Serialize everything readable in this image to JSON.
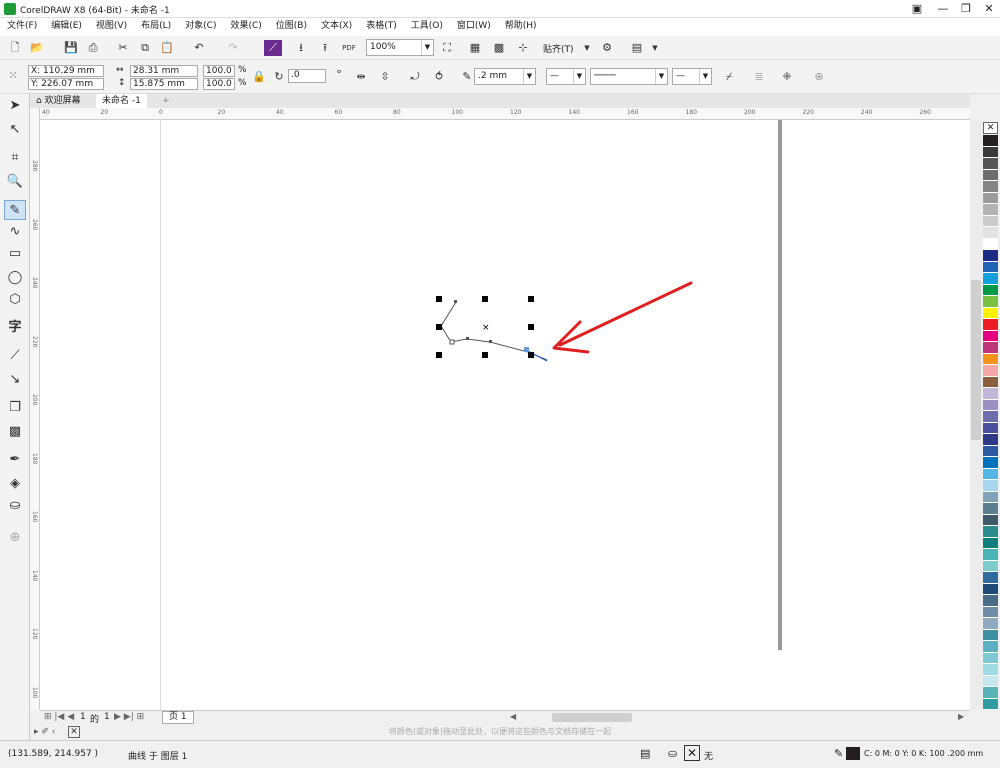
{
  "window": {
    "title": "CorelDRAW X8 (64-Bit) - 未命名 -1"
  },
  "menu": [
    "文件(F)",
    "编辑(E)",
    "视图(V)",
    "布局(L)",
    "对象(C)",
    "效果(C)",
    "位图(B)",
    "文本(X)",
    "表格(T)",
    "工具(O)",
    "窗口(W)",
    "帮助(H)"
  ],
  "toolbar1": {
    "zoom": "100%",
    "snap_label": "贴齐(T)"
  },
  "property_bar": {
    "x": "X: 110.29 mm",
    "y": "Y: 226.07 mm",
    "width": "28.31 mm",
    "height": "15.875 mm",
    "scale_x": "100.0",
    "scale_y": "100.0",
    "pct": "%",
    "rotation": ".0",
    "outline_width": ".2 mm"
  },
  "tabs": [
    {
      "label": "欢迎屏幕"
    },
    {
      "label": "未命名 -1"
    }
  ],
  "ruler": {
    "h_ticks": [
      "40",
      "20",
      "0",
      "20",
      "40",
      "60",
      "80",
      "100",
      "120",
      "140",
      "160",
      "180",
      "200",
      "220",
      "240",
      "260"
    ],
    "v_ticks": [
      "280",
      "260",
      "240",
      "220",
      "200",
      "180",
      "160",
      "140",
      "120",
      "100"
    ]
  },
  "page_nav": {
    "current": "1",
    "of": "的",
    "total": "1",
    "page_tab": "页 1"
  },
  "hint": "将颜色(或对象)拖动至此处，以便将这些颜色与文档存储在一起",
  "status": {
    "coords": "(131.589, 214.957 )",
    "object": "曲线 于 图层 1",
    "fill_none": "无",
    "outline_info": "C: 0 M: 0 Y: 0 K: 100  .200 mm"
  },
  "colors": {
    "arrow": "#e02020",
    "accent": "#1e9c38"
  },
  "palette": [
    "#231f20",
    "#3a3a3a",
    "#555",
    "#6d6d6d",
    "#858585",
    "#9c9c9c",
    "#b3b3b3",
    "#cbcbcb",
    "#e2e2e2",
    "#ffffff",
    "#1b2b86",
    "#1f63b5",
    "#12a1dd",
    "#009a49",
    "#7ac043",
    "#fff200",
    "#ed1c24",
    "#e4007f",
    "#c0347a",
    "#f7941d",
    "#f4a7a7",
    "#8b5e3c",
    "#c3b7d9",
    "#9b8fc4",
    "#6e6bb0",
    "#4b4f9b",
    "#2e3a87",
    "#2c5aa0",
    "#0072bc",
    "#54b6e6",
    "#a9d6ef",
    "#7fa4b8",
    "#5a7d8f",
    "#3d5a6b",
    "#2a8c8c",
    "#0f7d7d",
    "#4ab3b3",
    "#7fcccc",
    "#2e6b9e",
    "#1e4a7a",
    "#486b87",
    "#6e8ca6",
    "#8eaabf",
    "#3d8fa3",
    "#5cb0c4",
    "#7fc8d6",
    "#9fdbe3",
    "#c4e8ee",
    "#58b2b6",
    "#2f9ca3"
  ]
}
